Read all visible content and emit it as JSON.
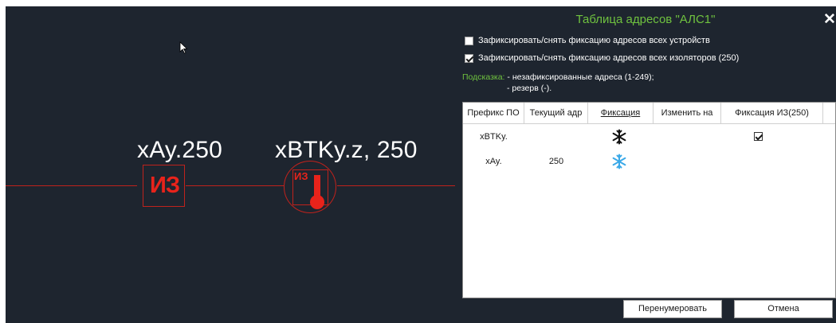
{
  "drawing": {
    "label_left": "xAy.250",
    "label_right": "xBTKy.z, 250",
    "iz_box_text": "ИЗ",
    "sensor_text": "ИЗ",
    "line_color": "#c0221c",
    "symbol_color": "#e8231b",
    "background": "#1e252f"
  },
  "dialog": {
    "title": "Таблица адресов \"АЛС1\"",
    "close_glyph": "✕",
    "checkbox_devices": {
      "label": "Зафиксировать/снять фиксацию адресов всех устройств",
      "checked": false
    },
    "checkbox_isolators": {
      "label": "Зафиксировать/снять фиксацию адресов всех изоляторов (250)",
      "checked": true
    },
    "hint_label": "Подсказка:",
    "hint_line1": " - незафиксированные адреса (1-249);",
    "hint_line2": "- резерв (-).",
    "accent": "#6fc23f"
  },
  "table": {
    "headers": [
      "Префикс ПО",
      "Текущий адр",
      "Фиксация",
      "Изменить на",
      "Фиксация ИЗ(250)"
    ],
    "rows": [
      {
        "prefix": "xBTKy.",
        "current": "",
        "fixation_icon": "snowflake-black-icon",
        "change_to": "",
        "fix_iz_checked": true
      },
      {
        "prefix": "xAy.",
        "current": "250",
        "fixation_icon": "snowflake-blue-icon",
        "change_to": "",
        "fix_iz_checked": false
      }
    ]
  },
  "buttons": {
    "renumber": "Перенумеровать",
    "cancel": "Отмена"
  }
}
